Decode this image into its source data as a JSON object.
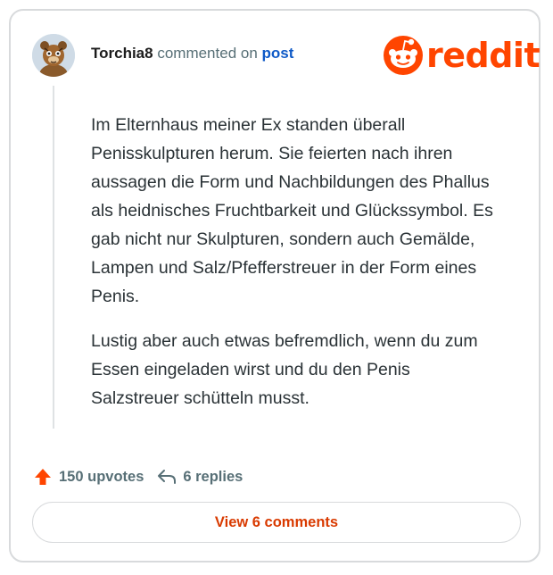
{
  "header": {
    "username": "Torchia8",
    "action_text": "commented on",
    "post_link": "post",
    "logo_icon": "reddit-snoo-icon",
    "logo_text": "reddit",
    "brand_color": "#ff4500"
  },
  "comment": {
    "paragraphs": [
      "Im Elternhaus meiner Ex standen überall Penisskulpturen herum. Sie feierten nach ihren aussagen die Form und Nachbildungen des Phallus als heidnisches Fruchtbarkeit und Glückssymbol. Es gab nicht nur Skulpturen, sondern auch Gemälde, Lampen und Salz/Pfefferstreuer in der Form eines Penis.",
      "Lustig aber auch etwas befremdlich, wenn du zum Essen eingeladen wirst und du den Penis Salzstreuer schütteln musst."
    ]
  },
  "footer": {
    "upvote_icon": "upvote-arrow-icon",
    "upvotes_label": "150 upvotes",
    "reply_icon": "reply-arrow-icon",
    "replies_label": "6 replies",
    "view_button_label": "View 6 comments",
    "accent_color": "#d93a00"
  }
}
